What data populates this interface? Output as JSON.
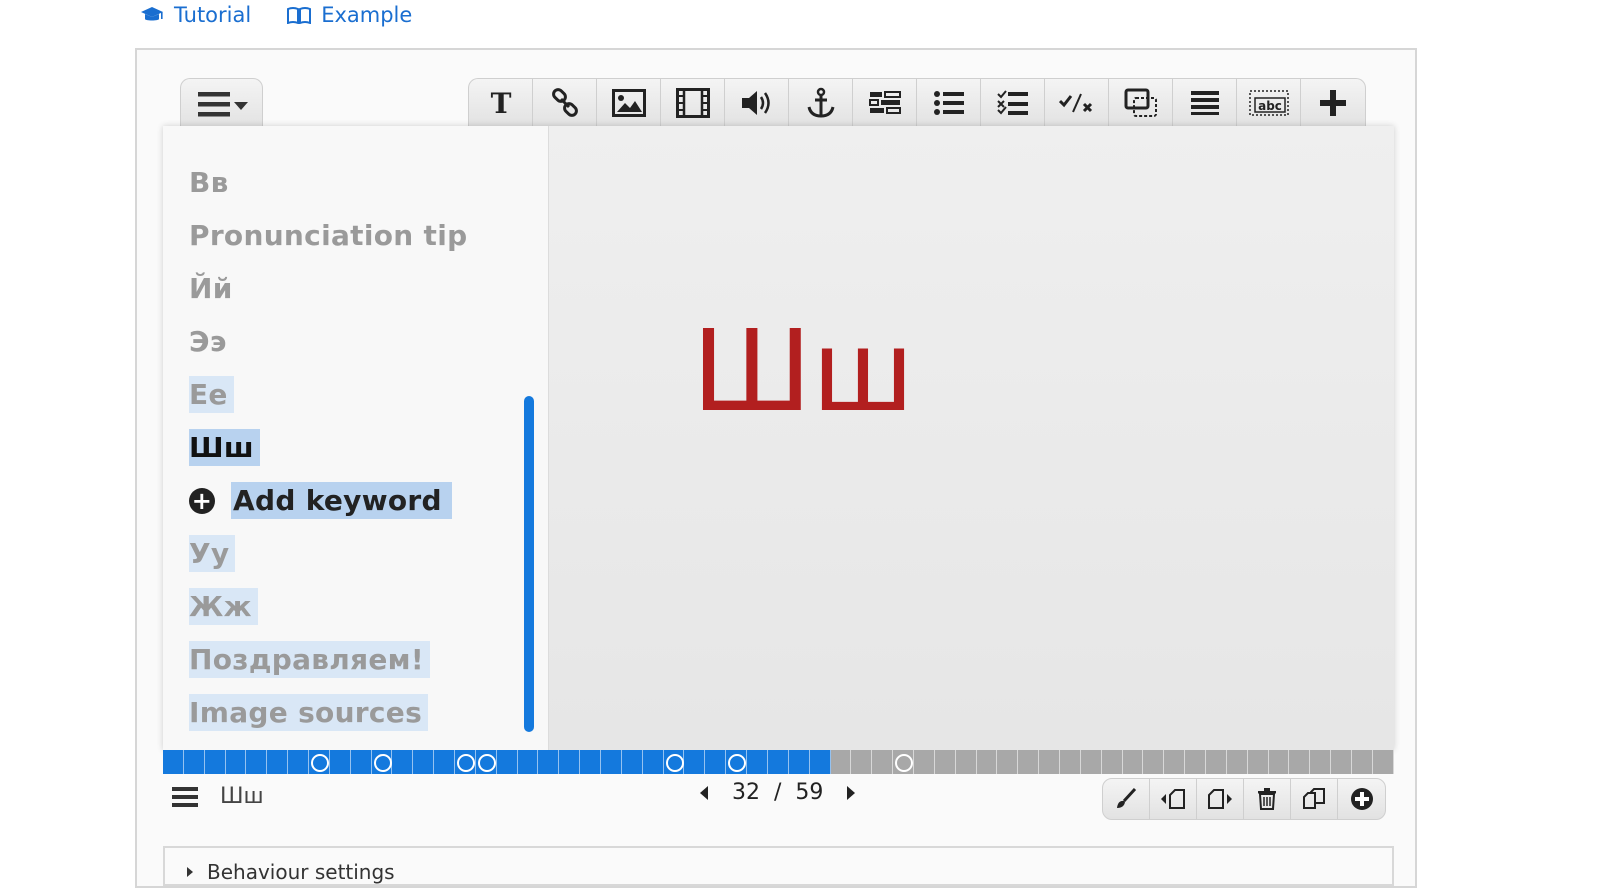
{
  "top_links": {
    "tutorial": "Tutorial",
    "example": "Example"
  },
  "toolbar": {
    "tools": [
      "text-icon",
      "link-icon",
      "image-icon",
      "video-icon",
      "audio-icon",
      "anchor-icon",
      "table-icon",
      "list-icon",
      "checklist-icon",
      "true-false-icon",
      "dialog-icon",
      "ordered-list-icon",
      "blanks-icon",
      "add-icon"
    ]
  },
  "sidebar": {
    "keywords": [
      {
        "label": "Вв",
        "state": "normal"
      },
      {
        "label": "Pronunciation tip",
        "state": "normal"
      },
      {
        "label": "Йй",
        "state": "normal"
      },
      {
        "label": "Ээ",
        "state": "normal"
      },
      {
        "label": "Ее",
        "state": "highlight"
      },
      {
        "label": "Шш",
        "state": "active"
      },
      {
        "label": "Add keyword",
        "state": "add"
      },
      {
        "label": "Уу",
        "state": "highlight"
      },
      {
        "label": "Жж",
        "state": "highlight"
      },
      {
        "label": "Поздравляем!",
        "state": "highlight"
      },
      {
        "label": "Image sources",
        "state": "highlight"
      }
    ]
  },
  "slide": {
    "big_text": "Шш"
  },
  "progress": {
    "current": 32,
    "total": 59
  },
  "footer": {
    "slide_title": "Шш",
    "current": "32",
    "separator": "/",
    "total": "59"
  },
  "behaviour": {
    "label": "Behaviour settings"
  },
  "colors": {
    "accent": "#1479dd",
    "letter": "#b21f1f"
  }
}
